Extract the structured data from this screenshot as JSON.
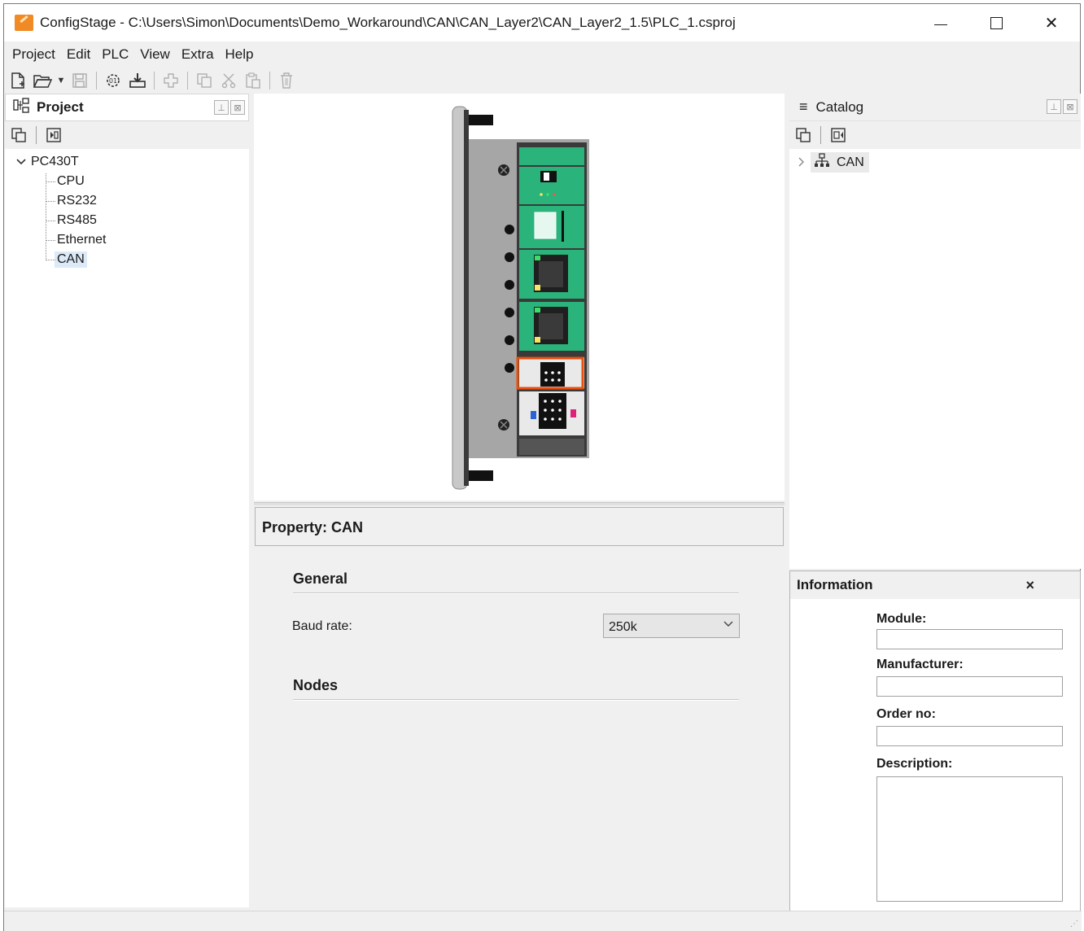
{
  "window": {
    "title": "ConfigStage - C:\\Users\\Simon\\Documents\\Demo_Workaround\\CAN\\CAN_Layer2\\CAN_Layer2_1.5\\PLC_1.csproj",
    "controls": {
      "minimize": "–",
      "maximize": "☐",
      "close": "✕"
    }
  },
  "menu": [
    "Project",
    "Edit",
    "PLC",
    "View",
    "Extra",
    "Help"
  ],
  "toolbar": {
    "new": "new-file-icon",
    "open": "open-folder-icon",
    "save": "save-icon",
    "compile": "compile-icon",
    "download": "download-icon",
    "add": "add-icon",
    "copy": "copy-icon",
    "cut": "cut-icon",
    "paste": "paste-icon",
    "delete": "delete-icon"
  },
  "project_panel": {
    "title": "Project",
    "tree": {
      "root": "PC430T",
      "children": [
        "CPU",
        "RS232",
        "RS485",
        "Ethernet",
        "CAN"
      ],
      "selected": "CAN"
    }
  },
  "property": {
    "title": "Property: CAN",
    "general": "General",
    "baud_label": "Baud rate:",
    "baud_value": "250k",
    "nodes": "Nodes"
  },
  "catalog": {
    "title": "Catalog",
    "item": "CAN"
  },
  "information": {
    "title": "Information",
    "close": "×",
    "module_label": "Module:",
    "manufacturer_label": "Manufacturer:",
    "order_label": "Order no:",
    "description_label": "Description:"
  },
  "colors": {
    "device_green": "#2ab37a",
    "device_dark": "#3a3a3a",
    "highlight_orange": "#e8500f",
    "selection": "#dceaf8"
  }
}
